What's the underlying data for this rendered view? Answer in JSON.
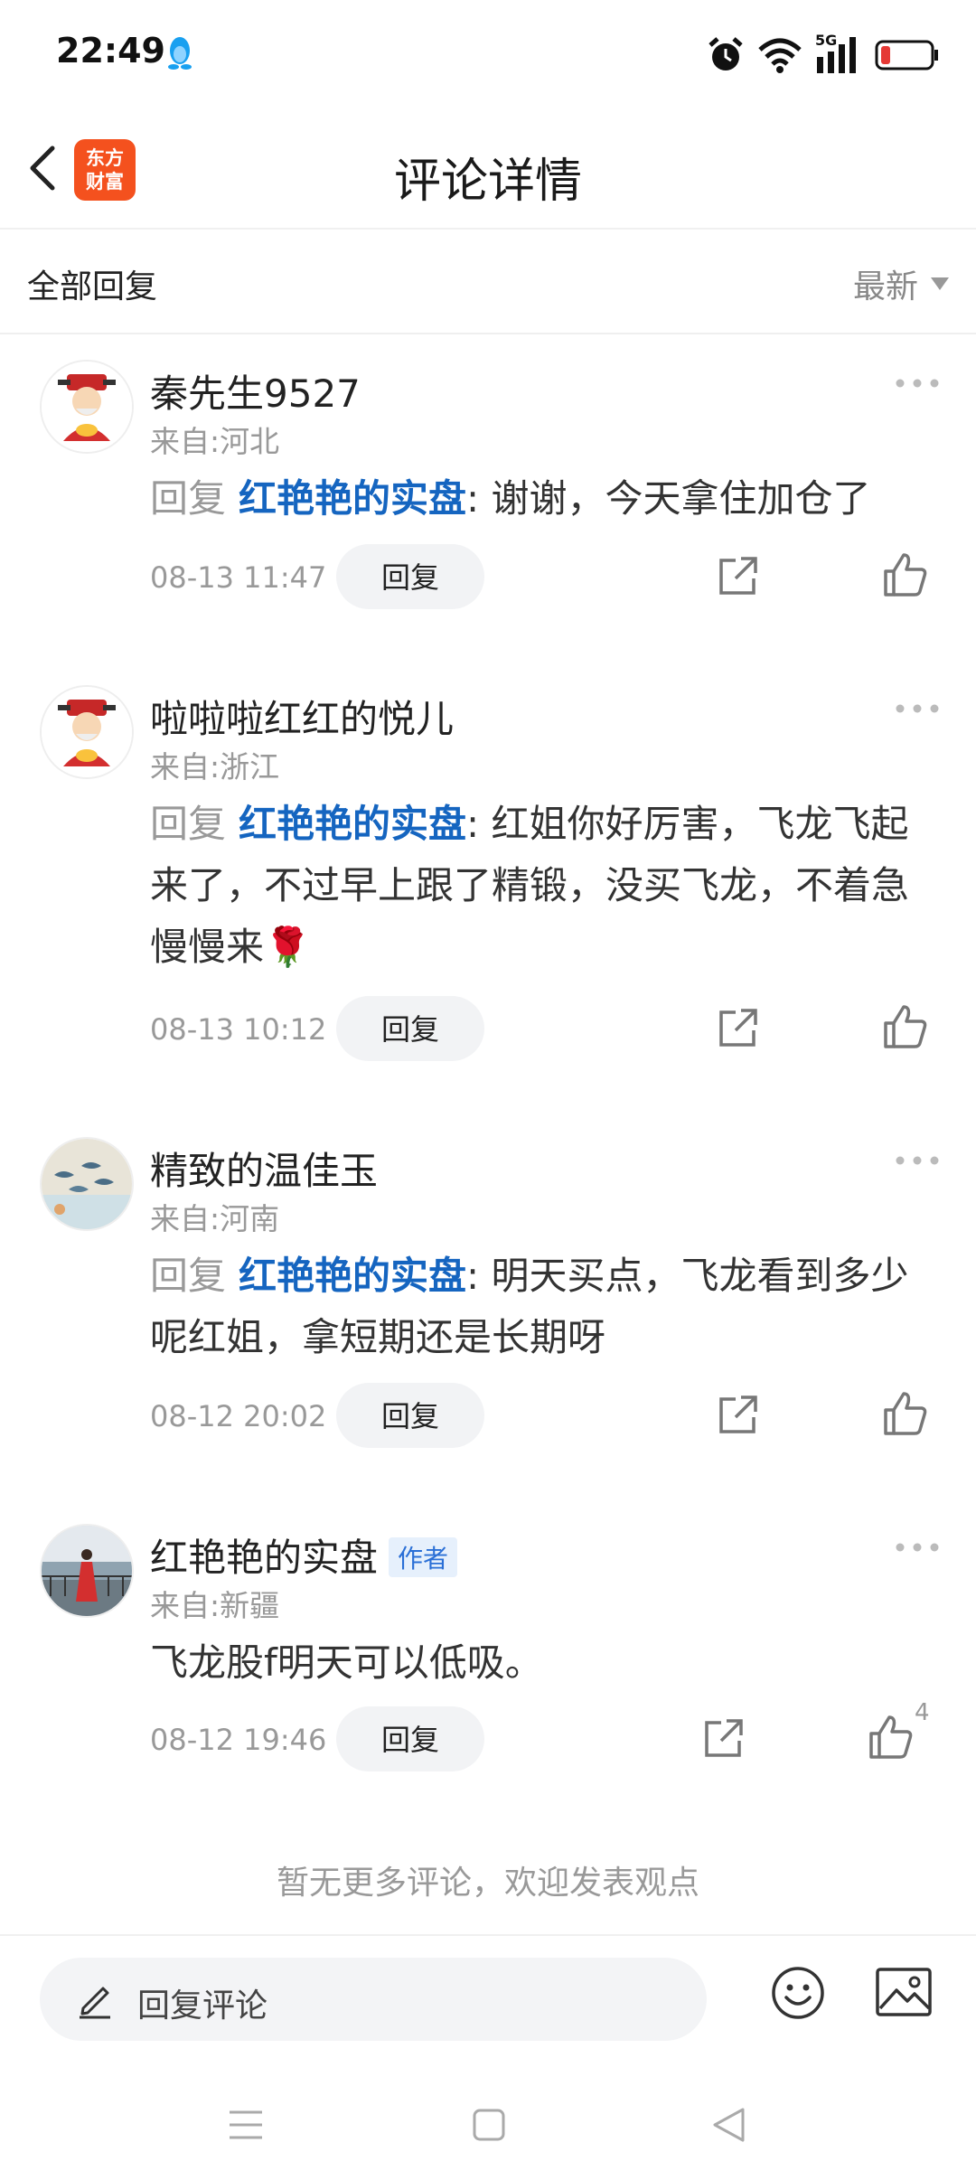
{
  "status_bar": {
    "time": "22:49",
    "network_label": "5G"
  },
  "header": {
    "title": "评论详情",
    "logo_line1": "东方",
    "logo_line2": "财富"
  },
  "filter": {
    "all_replies": "全部回复",
    "sort_label": "最新"
  },
  "comments": [
    {
      "name": "秦先生9527",
      "location": "来自:河北",
      "reply_prefix": "回复",
      "reply_target": "红艳艳的实盘",
      "body": ": 谢谢，今天拿住加仓了",
      "time": "08-13 11:47",
      "reply_label": "回复",
      "avatar_icon": "fortune-god-avatar"
    },
    {
      "name": "啦啦啦红红的悦儿",
      "location": "来自:浙江",
      "reply_prefix": "回复",
      "reply_target": "红艳艳的实盘",
      "body": ": 红姐你好厉害，飞龙飞起来了，不过早上跟了精锻，没买飞龙，不着急慢慢来🌹",
      "time": "08-13 10:12",
      "reply_label": "回复",
      "avatar_icon": "fortune-god-avatar"
    },
    {
      "name": "精致的温佳玉",
      "location": "来自:河南",
      "reply_prefix": "回复",
      "reply_target": "红艳艳的实盘",
      "body": ": 明天买点，飞龙看到多少呢红姐，拿短期还是长期呀",
      "time": "08-12 20:02",
      "reply_label": "回复",
      "avatar_icon": "fish-painting-avatar"
    },
    {
      "name": "红艳艳的实盘",
      "author_badge": "作者",
      "location": "来自:新疆",
      "body": "飞龙股f明天可以低吸。",
      "time": "08-12 19:46",
      "reply_label": "回复",
      "like_count": "4",
      "avatar_icon": "woman-seaside-avatar"
    }
  ],
  "footer_note": "暂无更多评论，欢迎发表观点",
  "input_bar": {
    "placeholder": "回复评论"
  },
  "colors": {
    "link_blue": "#1565c0",
    "brand_orange": "#f4511e",
    "muted_gray": "#999999"
  }
}
